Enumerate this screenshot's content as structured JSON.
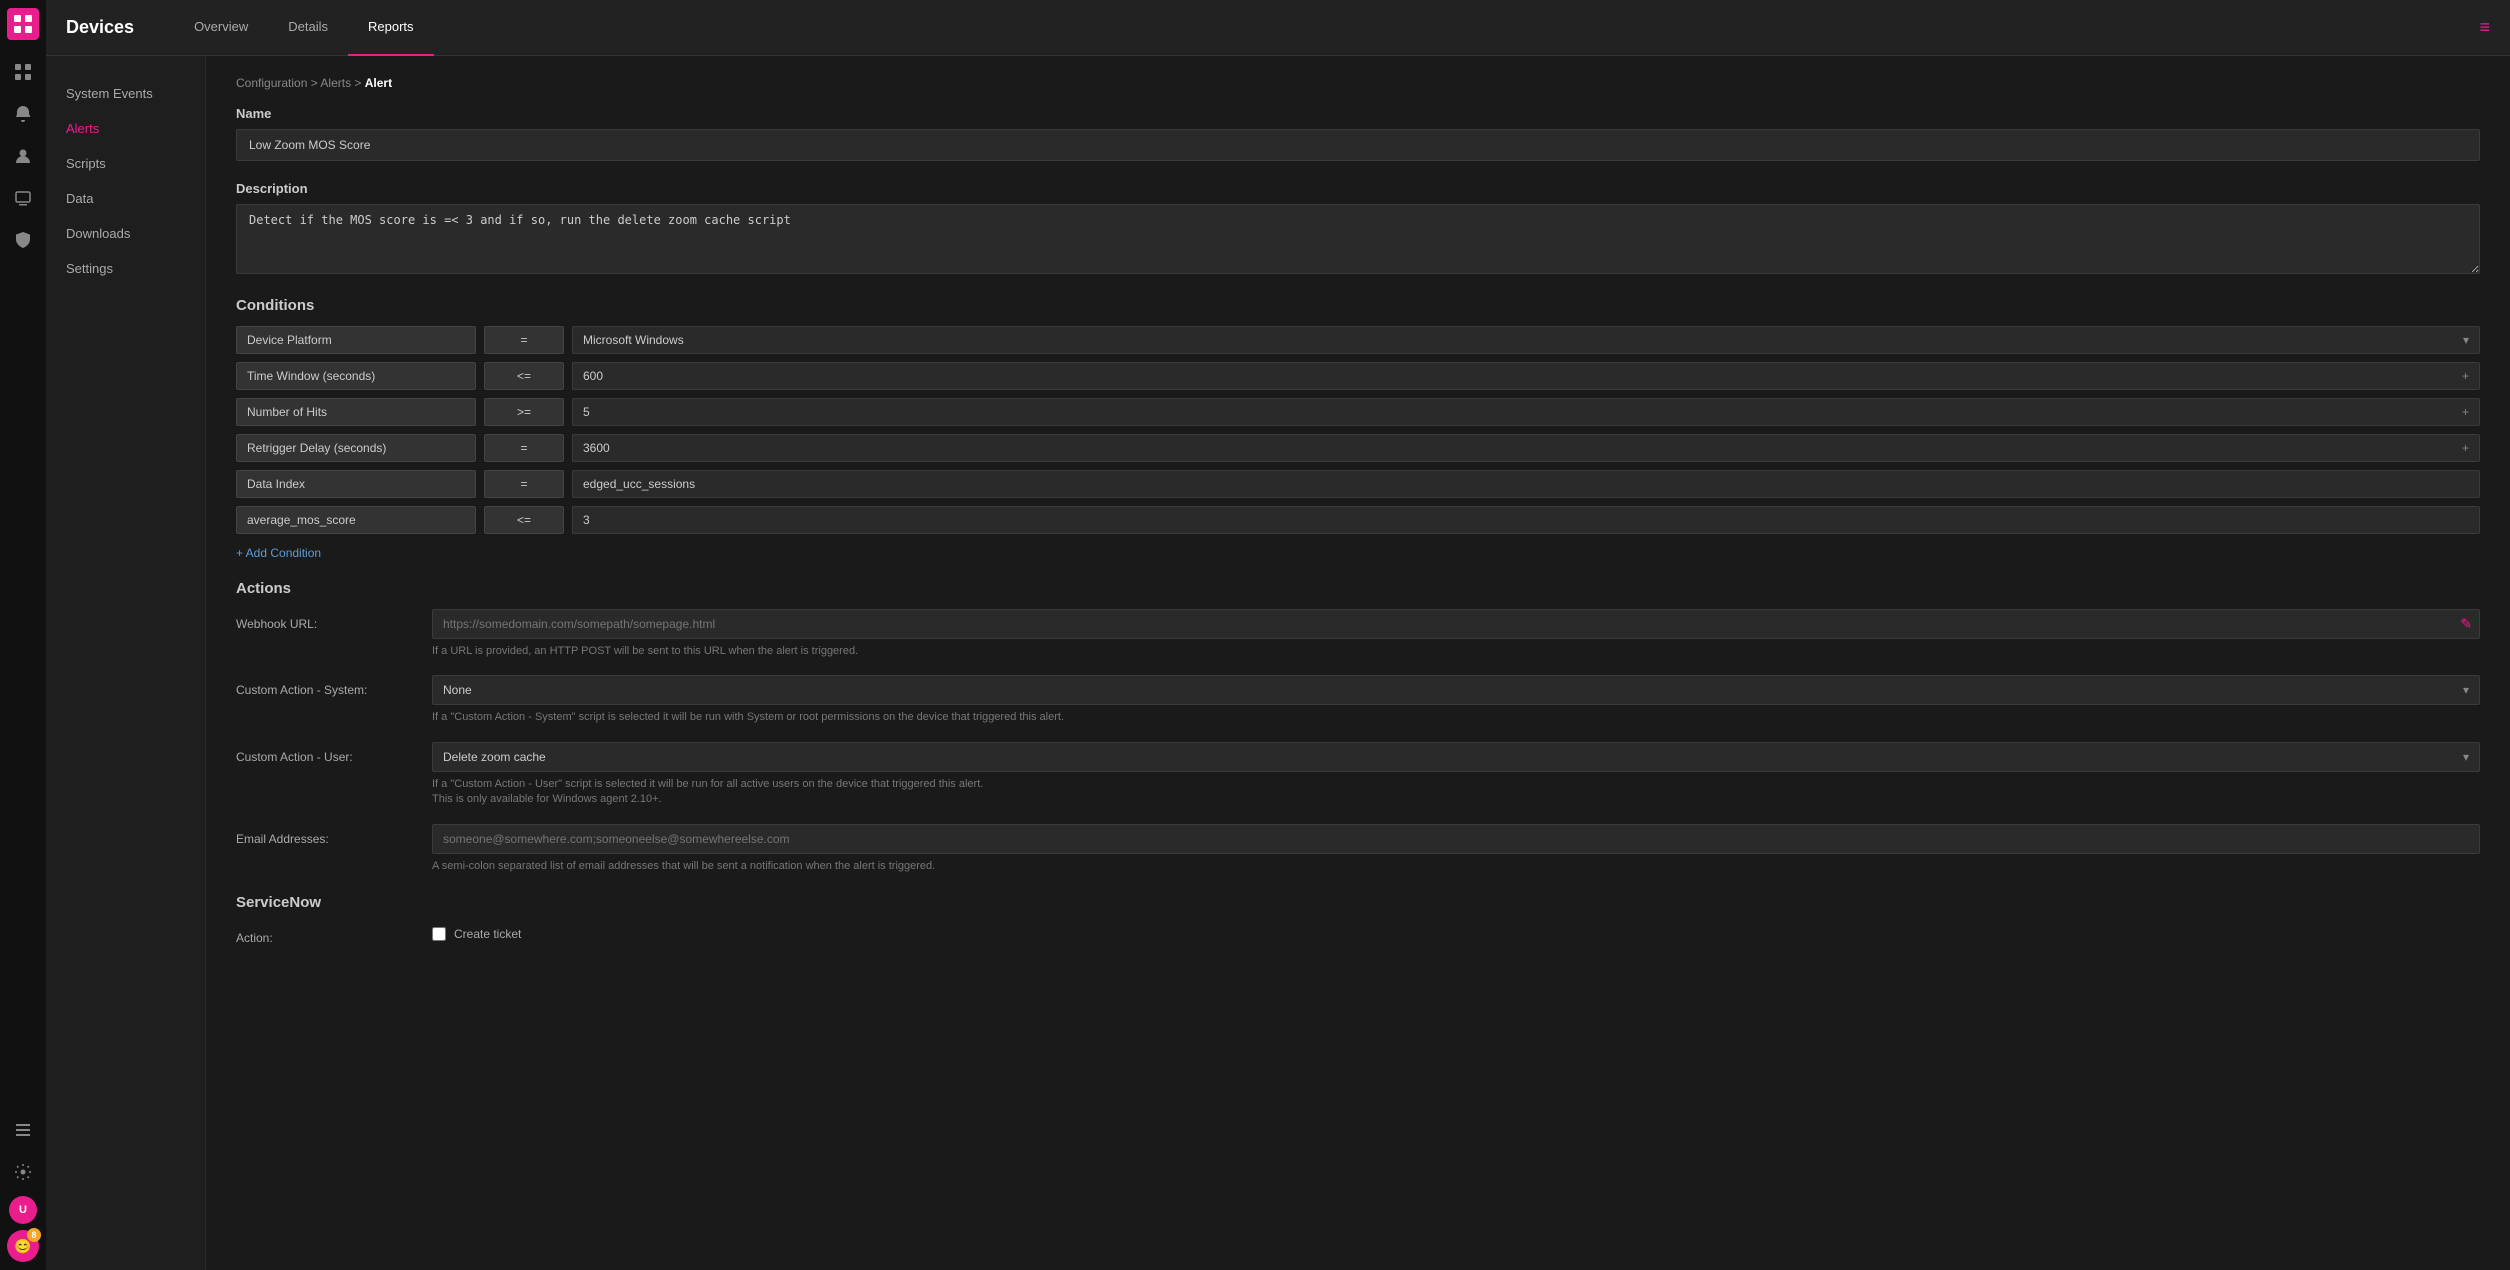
{
  "app": {
    "title": "Devices"
  },
  "header": {
    "title": "Devices",
    "nav": [
      {
        "id": "overview",
        "label": "Overview",
        "active": false
      },
      {
        "id": "details",
        "label": "Details",
        "active": false
      },
      {
        "id": "reports",
        "label": "Reports",
        "active": true
      }
    ]
  },
  "sidebar": {
    "items": [
      {
        "id": "system-events",
        "label": "System Events",
        "active": false
      },
      {
        "id": "alerts",
        "label": "Alerts",
        "active": true
      },
      {
        "id": "scripts",
        "label": "Scripts",
        "active": false
      },
      {
        "id": "data",
        "label": "Data",
        "active": false
      },
      {
        "id": "downloads",
        "label": "Downloads",
        "active": false
      },
      {
        "id": "settings",
        "label": "Settings",
        "active": false
      }
    ]
  },
  "breadcrumb": {
    "path": "Configuration > Alerts > ",
    "current": "Alert"
  },
  "form": {
    "name_label": "Name",
    "name_value": "Low Zoom MOS Score",
    "description_label": "Description",
    "description_value": "Detect if the MOS score is =< 3 and if so, run the delete zoom cache script",
    "conditions_title": "Conditions",
    "conditions": [
      {
        "field": "Device Platform",
        "op": "=",
        "value": "Microsoft Windows",
        "type": "dropdown"
      },
      {
        "field": "Time Window (seconds)",
        "op": "<=",
        "value": "600",
        "type": "number"
      },
      {
        "field": "Number of Hits",
        "op": ">=",
        "value": "5",
        "type": "number"
      },
      {
        "field": "Retrigger Delay (seconds)",
        "op": "=",
        "value": "3600",
        "type": "number"
      },
      {
        "field": "Data Index",
        "op": "=",
        "value": "edged_ucc_sessions",
        "type": "text"
      },
      {
        "field": "average_mos_score",
        "op": "<=",
        "value": "3",
        "type": "text"
      }
    ],
    "add_condition_label": "+ Add Condition",
    "actions_title": "Actions",
    "webhook_label": "Webhook URL:",
    "webhook_placeholder": "https://somedomain.com/somepath/somepage.html",
    "webhook_hint": "If a URL is provided, an HTTP POST will be sent to this URL when the alert is triggered.",
    "custom_system_label": "Custom Action - System:",
    "custom_system_value": "None",
    "custom_system_hint": "If a \"Custom Action - System\" script is selected it will be run with System or root permissions on the device that triggered this alert.",
    "custom_user_label": "Custom Action - User:",
    "custom_user_value": "Delete zoom cache",
    "custom_user_hint": "If a \"Custom Action - User\" script is selected it will be run for all active users on the device that triggered this alert.\nThis is only available for Windows agent 2.10+.",
    "email_label": "Email Addresses:",
    "email_placeholder": "someone@somewhere.com;someoneelse@somewhereelse.com",
    "email_hint": "A semi-colon separated list of email addresses that will be sent a notification when the alert is triggered.",
    "servicenow_title": "ServiceNow",
    "action_label_sn": "Action:",
    "create_ticket_label": "Create ticket",
    "create_ticket_checked": false
  },
  "icons": {
    "grid": "▦",
    "bell": "🔔",
    "person": "👤",
    "chat": "💬",
    "shield": "🛡",
    "list": "☰",
    "settings": "⚙",
    "chevron_down": "▾",
    "plus": "+",
    "hamburger": "≡",
    "dashboard": "⊞"
  },
  "colors": {
    "accent": "#e91e8c",
    "link": "#5b9bd5"
  }
}
